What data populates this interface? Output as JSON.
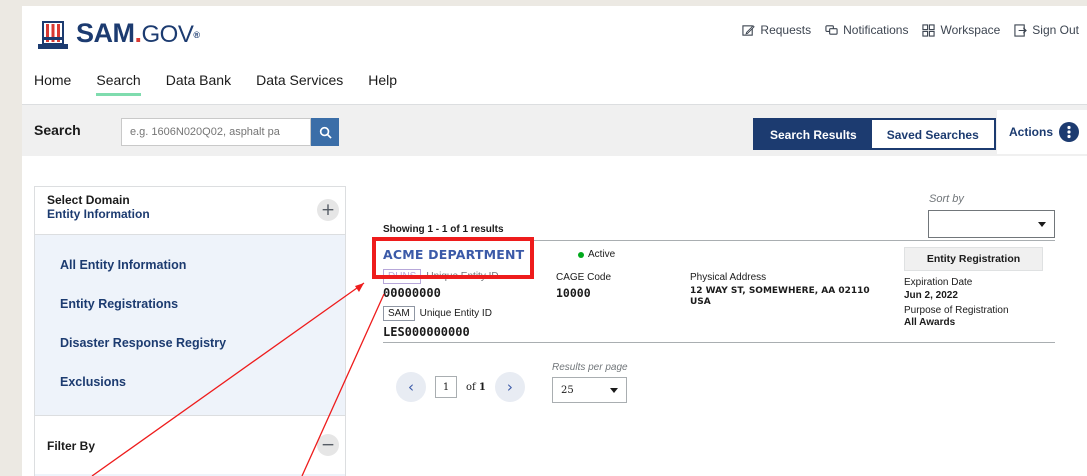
{
  "header": {
    "logo_main": "SAM",
    "logo_dot": ".",
    "logo_gov": "GOV",
    "logo_reg": "®",
    "utility": [
      {
        "label": "Requests",
        "icon": "edit-icon"
      },
      {
        "label": "Notifications",
        "icon": "chat-icon"
      },
      {
        "label": "Workspace",
        "icon": "grid-icon"
      },
      {
        "label": "Sign Out",
        "icon": "signout-icon"
      }
    ],
    "nav": [
      "Home",
      "Search",
      "Data Bank",
      "Data Services",
      "Help"
    ]
  },
  "search": {
    "label": "Search",
    "placeholder": "e.g. 1606N020Q02, asphalt pa",
    "tabs": [
      "Search Results",
      "Saved Searches"
    ],
    "actions_label": "Actions"
  },
  "sidebar": {
    "domain_label": "Select Domain",
    "domain_value": "Entity Information",
    "items": [
      "All Entity Information",
      "Entity Registrations",
      "Disaster Response Registry",
      "Exclusions"
    ],
    "filter_label": "Filter By"
  },
  "results": {
    "sort_label": "Sort by",
    "showing": "Showing 1 - 1 of 1 results",
    "entity_name": "ACME DEPARTMENT",
    "status": "Active",
    "duns_tag": "DUNS",
    "duns_label": "Unique Entity ID",
    "duns_value": "00000000",
    "sam_tag": "SAM",
    "sam_label": "Unique Entity ID",
    "sam_value": "LES000000000",
    "cage_label": "CAGE Code",
    "cage_value": "10000",
    "address_label": "Physical Address",
    "address_value": "12 WAY ST, SOMEWHERE, AA 02110 USA",
    "registration_button": "Entity Registration",
    "expiration_label": "Expiration Date",
    "expiration_value": "Jun 2, 2022",
    "purpose_label": "Purpose of Registration",
    "purpose_value": "All Awards"
  },
  "pagination": {
    "prev": "‹",
    "next": "›",
    "current_page": "1",
    "of_label": "of",
    "total_pages": "1",
    "per_page_label": "Results per page",
    "per_page_value": "25"
  },
  "colors": {
    "brand_navy": "#1c3b70",
    "link_blue": "#3b5aa8",
    "active_green": "#00a91c",
    "nav_underline": "#7fdcae",
    "highlight_red": "#ee1c1c"
  }
}
